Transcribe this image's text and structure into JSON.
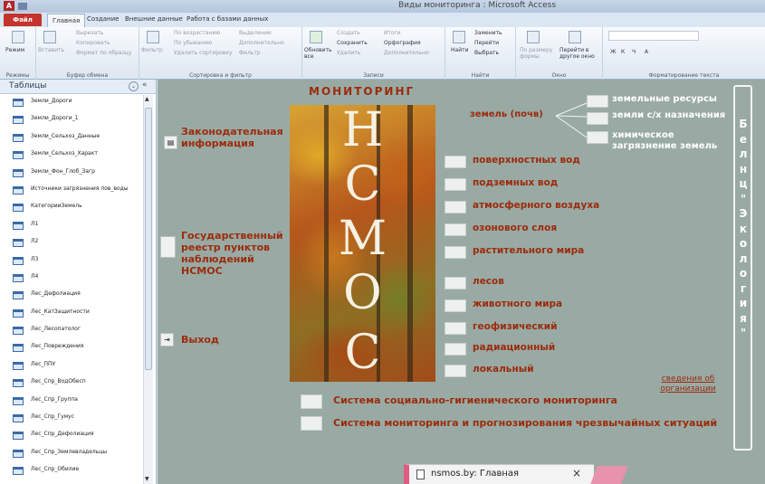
{
  "window": {
    "title": "Виды мониторинга : Microsoft Access",
    "qat_icon": "access-icon"
  },
  "tabs": {
    "file": "Файл",
    "items": [
      "Главная",
      "Создание",
      "Внешние данные",
      "Работа с базами данных"
    ]
  },
  "ribbon": {
    "groups": [
      {
        "label": "Режимы",
        "buttons": [
          "Режим"
        ]
      },
      {
        "label": "Буфер обмена",
        "buttons": [
          "Вставить",
          "Вырезать",
          "Копировать",
          "Формат по образцу"
        ]
      },
      {
        "label": "Сортировка и фильтр",
        "buttons": [
          "Фильтр",
          "По возрастанию",
          "По убыванию",
          "Удалить сортировку",
          "Выделение",
          "Дополнительно",
          "Фильтр"
        ]
      },
      {
        "label": "Записи",
        "buttons": [
          "Обновить все",
          "Создать",
          "Сохранить",
          "Удалить",
          "Итоги",
          "Орфография",
          "Дополнительно"
        ]
      },
      {
        "label": "Найти",
        "buttons": [
          "Найти",
          "Заменить",
          "Перейти",
          "Выбрать"
        ]
      },
      {
        "label": "Окно",
        "buttons": [
          "По размеру формы",
          "Перейти в другое окно"
        ]
      },
      {
        "label": "Форматирование текста",
        "buttons": [
          "Ж",
          "К",
          "Ч",
          "А"
        ]
      }
    ]
  },
  "nav": {
    "header": "Таблицы",
    "items": [
      "Земли_Дороги",
      "Земли_Дороги_1",
      "Земли_Сельхоз_Данные",
      "Земли_Сельхоз_Характ",
      "Земли_Фон_Глоб_Загр",
      "Источники загрязнения пов_воды",
      "КатегорииЗемель",
      "Л1",
      "Л2",
      "Л3",
      "Л4",
      "Лес_Дефолиация",
      "Лес_КатЗащитности",
      "Лес_Лесопатолог",
      "Лес_Повреждения",
      "Лес_ППУ",
      "Лес_Спр_ВодОбесп",
      "Лес_Спр_Группа",
      "Лес_Спр_Гумус",
      "Лес_Спр_Дефолиация",
      "Лес_Спр_Землевладельцы",
      "Лес_Спр_Обилие"
    ]
  },
  "form": {
    "title": "МОНИТОРИНГ",
    "photo_letters": [
      "Н",
      "С",
      "М",
      "О",
      "С"
    ],
    "left_buttons": {
      "legislation": "Законодательная информация",
      "registry": "Государственный реестр пунктов наблюдений НСМОС",
      "exit": "Выход"
    },
    "land_label": "земель (почв)",
    "land_subitems": [
      "земельные ресурсы",
      "земли с/х назначения",
      "химическое загрязнение земель"
    ],
    "monitoring_types": [
      "поверхностных вод",
      "подземных вод",
      "атмосферного воздуха",
      "озонового слоя",
      "растительного мира",
      "лесов",
      "животного мира",
      "геофизический",
      "радиационный",
      "локальный"
    ],
    "org_link": "сведения об организации",
    "systems": [
      "Система социально-гигиенического мониторинга",
      "Система мониторинга и прогнозирования чрезвычайных ситуаций"
    ],
    "vertical_text": "Белнц\"Экология\""
  },
  "browser": {
    "tab_title": "nsmos.by: Главная",
    "close": "×"
  }
}
